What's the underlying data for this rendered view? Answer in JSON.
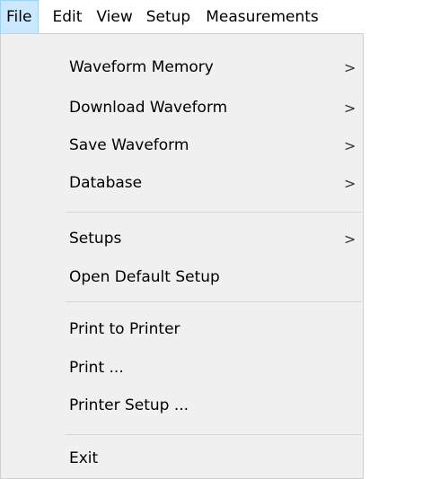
{
  "menubar": {
    "items": [
      {
        "label": "File",
        "active": true
      },
      {
        "label": "Edit",
        "active": false
      },
      {
        "label": "View",
        "active": false
      },
      {
        "label": "Setup",
        "active": false
      },
      {
        "label": "Measurements",
        "active": false
      }
    ]
  },
  "file_menu": {
    "groups": [
      [
        {
          "label": "Waveform Memory",
          "submenu_arrow": ">"
        },
        {
          "label": "Download Waveform",
          "submenu_arrow": ">"
        },
        {
          "label": "Save Waveform",
          "submenu_arrow": ">"
        },
        {
          "label": "Database",
          "submenu_arrow": ">"
        }
      ],
      [
        {
          "label": "Setups",
          "submenu_arrow": ">"
        },
        {
          "label": "Open Default Setup"
        }
      ],
      [
        {
          "label": "Print to Printer"
        },
        {
          "label": "Print ..."
        },
        {
          "label": "Printer Setup ..."
        }
      ],
      [
        {
          "label": "Exit"
        }
      ]
    ]
  },
  "colors": {
    "menubar_active_bg": "#cce8ff",
    "menubar_active_border": "#99d1ff",
    "dropdown_bg": "#f0f0f0",
    "separator": "#d7d7d7"
  }
}
